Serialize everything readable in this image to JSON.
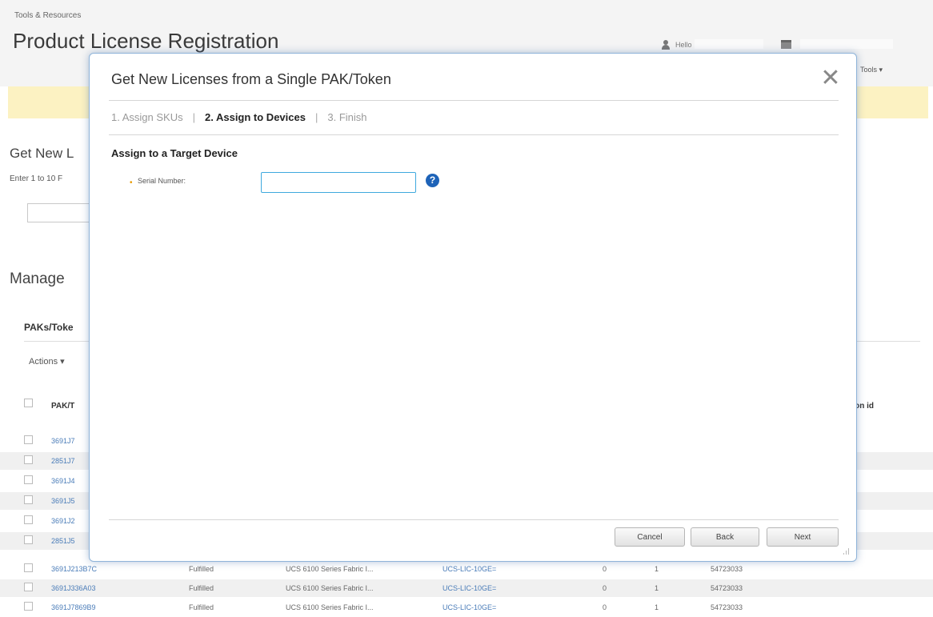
{
  "page": {
    "breadcrumb": "Tools & Resources",
    "title": "Product License Registration",
    "hello": "Hello",
    "tools_menu": "Tools ▾",
    "get_new_heading": "Get New L",
    "enter_text": "Enter 1 to 10 F",
    "manage_heading": "Manage",
    "paks_label": "PAKs/Toke",
    "actions_menu": "Actions ▾",
    "table": {
      "col_pak": "PAK/T",
      "col_tx": "tion id",
      "rows": [
        {
          "pak": "3691J7",
          "status": "",
          "desc": "",
          "sku": "",
          "a": "",
          "b": "",
          "order": ""
        },
        {
          "pak": "2851J7",
          "status": "",
          "desc": "",
          "sku": "",
          "a": "",
          "b": "",
          "order": ""
        },
        {
          "pak": "3691J4",
          "status": "",
          "desc": "",
          "sku": "",
          "a": "",
          "b": "",
          "order": ""
        },
        {
          "pak": "3691J5",
          "status": "",
          "desc": "",
          "sku": "",
          "a": "",
          "b": "",
          "order": ""
        },
        {
          "pak": "3691J2",
          "status": "",
          "desc": "",
          "sku": "",
          "a": "",
          "b": "",
          "order": ""
        },
        {
          "pak": "2851J5",
          "status": "",
          "desc": "",
          "sku": "",
          "a": "",
          "b": "",
          "order": ""
        },
        {
          "pak": "3691J213B7C",
          "status": "Fulfilled",
          "desc": "UCS 6100 Series Fabric I...",
          "sku": "UCS-LIC-10GE=",
          "a": "0",
          "b": "1",
          "order": "54723033"
        },
        {
          "pak": "3691J336A03",
          "status": "Fulfilled",
          "desc": "UCS 6100 Series Fabric I...",
          "sku": "UCS-LIC-10GE=",
          "a": "0",
          "b": "1",
          "order": "54723033"
        },
        {
          "pak": "3691J7869B9",
          "status": "Fulfilled",
          "desc": "UCS 6100 Series Fabric I...",
          "sku": "UCS-LIC-10GE=",
          "a": "0",
          "b": "1",
          "order": "54723033"
        }
      ]
    }
  },
  "modal": {
    "title": "Get New Licenses from a Single PAK/Token",
    "close_glyph": "✕",
    "steps": [
      {
        "label": "1. Assign SKUs"
      },
      {
        "label": "2. Assign to Devices"
      },
      {
        "label": "3. Finish"
      }
    ],
    "step_separator": "|",
    "section_heading": "Assign to a Target Device",
    "required_marker": "•",
    "serial_label": "Serial Number:",
    "serial_value": "",
    "help_glyph": "?",
    "buttons": {
      "cancel": "Cancel",
      "back": "Back",
      "next": "Next"
    }
  },
  "colors": {
    "accent_blue": "#1e63b8",
    "link_blue": "#4a7cb8",
    "warning_bar": "#fcf2c2",
    "required_orange": "#e89a00",
    "modal_border": "#8fb4d9"
  }
}
